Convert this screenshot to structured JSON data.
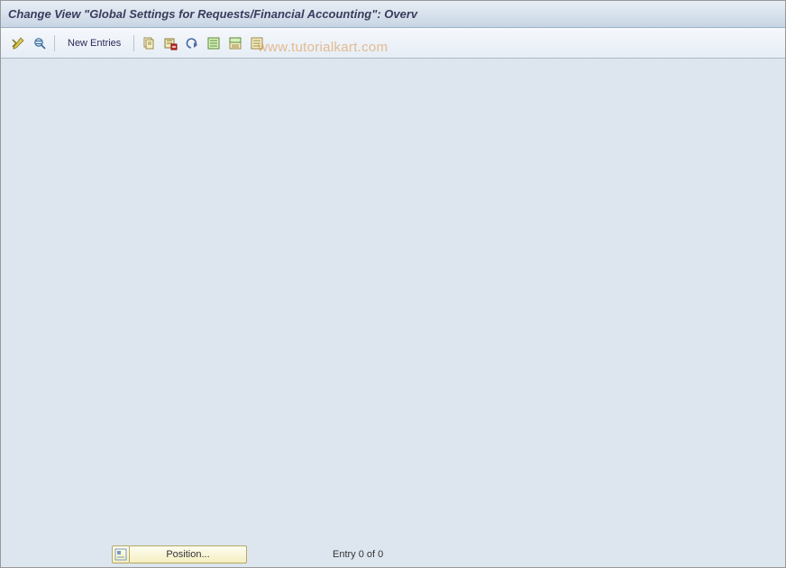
{
  "header": {
    "title": "Change View \"Global Settings for Requests/Financial Accounting\": Overv"
  },
  "toolbar": {
    "new_entries_label": "New Entries",
    "icons": {
      "toggle": "toggle-display-change",
      "detail": "detail-view",
      "copy": "copy-as",
      "delete": "delete",
      "undo": "undo",
      "select_all": "select-all",
      "select_block": "select-block",
      "deselect_all": "deselect-all"
    }
  },
  "watermark": {
    "text": "www.tutorialkart.com"
  },
  "footer": {
    "position_label": "Position...",
    "entry_status": "Entry 0 of 0"
  }
}
